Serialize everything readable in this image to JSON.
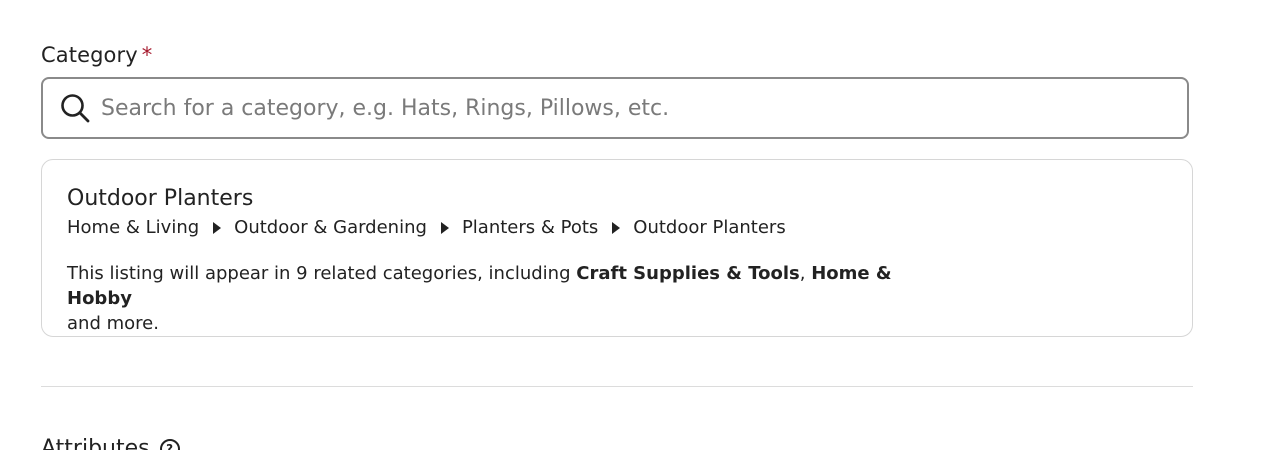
{
  "category_field": {
    "label": "Category",
    "required_marker": "*",
    "search_placeholder": "Search for a category, e.g. Hats, Rings, Pillows, etc.",
    "search_value": "",
    "search_icon": "search-icon"
  },
  "selected_category": {
    "title": "Outdoor Planters",
    "breadcrumb": [
      "Home & Living",
      "Outdoor & Gardening",
      "Planters & Pots",
      "Outdoor Planters"
    ],
    "related_prefix": "This listing will appear in 9 related categories, including ",
    "related_cat_1": "Craft Supplies & Tools",
    "related_sep": ", ",
    "related_cat_2": "Home & Hobby",
    "related_suffix": "and more."
  },
  "attributes_section": {
    "title": "Attributes",
    "help_icon": "help-circle-icon",
    "help_glyph": "?"
  },
  "colors": {
    "required": "#a61a2e",
    "text": "#222222",
    "placeholder": "#7a7a7a",
    "border": "#8a8a8a"
  }
}
